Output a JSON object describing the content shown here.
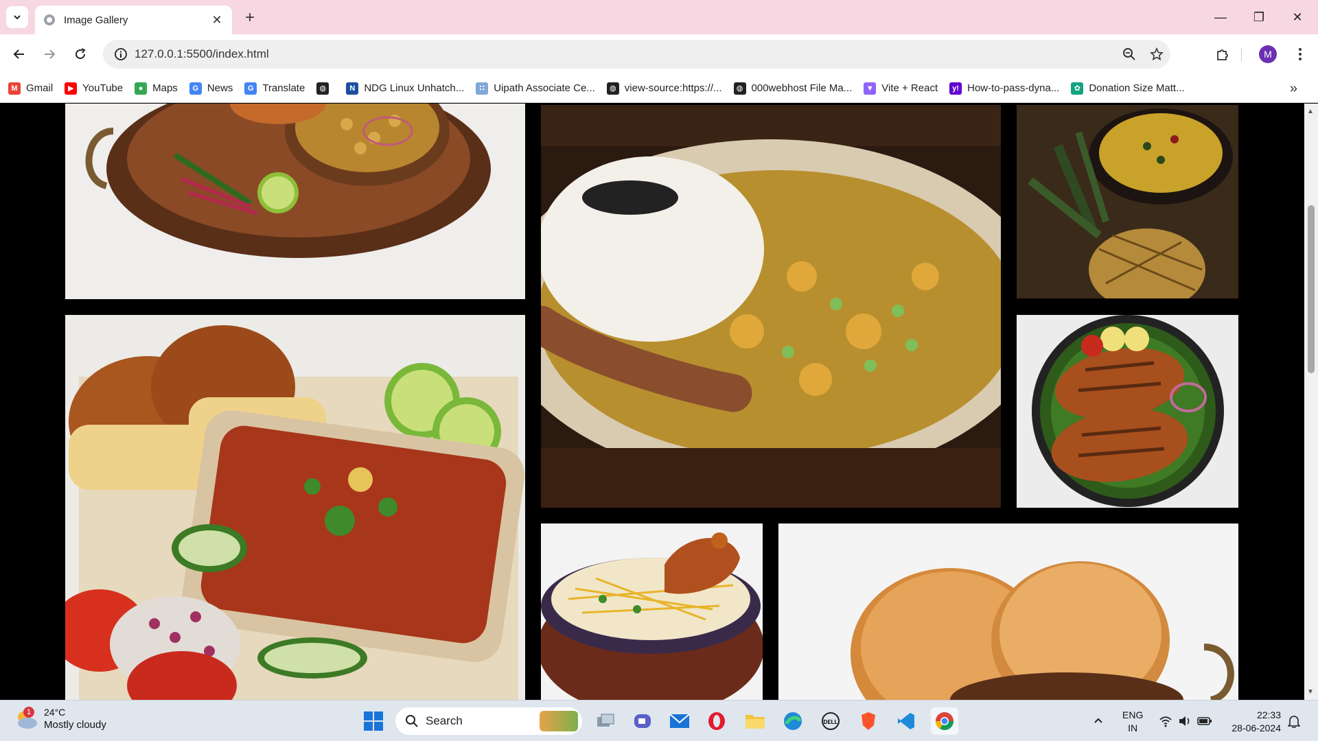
{
  "browser": {
    "tab": {
      "title": "Image Gallery"
    },
    "url": "127.0.0.1:5500/index.html",
    "profile_initial": "M",
    "bookmarks": [
      {
        "label": "Gmail",
        "icon": "gmail-icon",
        "color": "#ea4335",
        "glyph": "M"
      },
      {
        "label": "YouTube",
        "icon": "youtube-icon",
        "color": "#ff0000",
        "glyph": "▶"
      },
      {
        "label": "Maps",
        "icon": "maps-icon",
        "color": "#34a853",
        "glyph": "●"
      },
      {
        "label": "News",
        "icon": "news-icon",
        "color": "#4285f4",
        "glyph": "G"
      },
      {
        "label": "Translate",
        "icon": "translate-icon",
        "color": "#4285f4",
        "glyph": "G"
      },
      {
        "label": "",
        "icon": "globe-icon",
        "color": "#222222",
        "glyph": "◍"
      },
      {
        "label": "NDG Linux Unhatch...",
        "icon": "ndg-icon",
        "color": "#1a4fa0",
        "glyph": "N"
      },
      {
        "label": "Uipath Associate Ce...",
        "icon": "uipath-icon",
        "color": "#7fa7d8",
        "glyph": "∷"
      },
      {
        "label": "view-source:https://...",
        "icon": "globe-icon",
        "color": "#222222",
        "glyph": "◍"
      },
      {
        "label": "000webhost File Ma...",
        "icon": "globe-icon",
        "color": "#222222",
        "glyph": "◍"
      },
      {
        "label": "Vite + React",
        "icon": "vite-icon",
        "color": "#8f63f8",
        "glyph": "▼"
      },
      {
        "label": "How-to-pass-dyna...",
        "icon": "yahoo-icon",
        "color": "#6001d2",
        "glyph": "y!"
      },
      {
        "label": "Donation Size Matt...",
        "icon": "openai-icon",
        "color": "#10a37f",
        "glyph": "✿"
      }
    ]
  },
  "gallery": {
    "photos": [
      {
        "name": "photo-chole-plate",
        "desc": ""
      },
      {
        "name": "photo-rice-curry",
        "desc": ""
      },
      {
        "name": "photo-pineapple-curry",
        "desc": ""
      },
      {
        "name": "photo-pav-bhaji",
        "desc": ""
      },
      {
        "name": "photo-fried-fish",
        "desc": ""
      },
      {
        "name": "photo-chicken-biryani",
        "desc": ""
      },
      {
        "name": "photo-bhature",
        "desc": ""
      }
    ]
  },
  "taskbar": {
    "weather": {
      "temp": "24°C",
      "condition": "Mostly cloudy",
      "badge": "1"
    },
    "search_label": "Search",
    "lang_top": "ENG",
    "lang_bottom": "IN",
    "time": "22:33",
    "date": "28-06-2024"
  }
}
